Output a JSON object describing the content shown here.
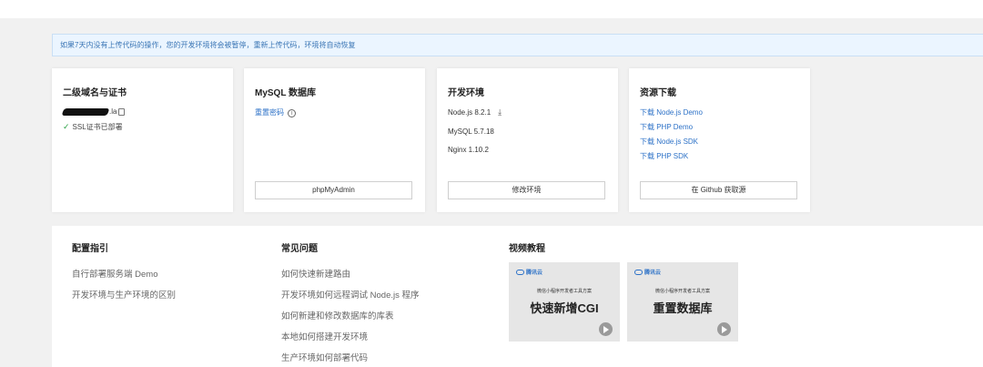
{
  "notice": "如果7天内没有上传代码的操作，您的开发环境将会被暂停，重新上传代码，环境将自动恢复",
  "cards": {
    "domain": {
      "title": "二级域名与证书",
      "domain_suffix": ".la",
      "ssl_status": "SSL证书已部署"
    },
    "mysql": {
      "title": "MySQL 数据库",
      "reset_password": "重置密码",
      "info_glyph": "i",
      "button": "phpMyAdmin"
    },
    "env": {
      "title": "开发环境",
      "node": "Node.js 8.2.1",
      "mysql": "MySQL 5.7.18",
      "nginx": "Nginx 1.10.2",
      "button": "修改环境"
    },
    "resources": {
      "title": "资源下载",
      "links": [
        "下载 Node.js Demo",
        "下载 PHP Demo",
        "下载 Node.js SDK",
        "下载 PHP SDK"
      ],
      "button": "在 Github 获取源"
    }
  },
  "guide": {
    "title": "配置指引",
    "links": [
      "自行部署服务端 Demo",
      "开发环境与生产环境的区别"
    ]
  },
  "faq": {
    "title": "常见问题",
    "links": [
      "如何快速新建路由",
      "开发环境如何远程调试 Node.js 程序",
      "如何新建和修改数据库的库表",
      "本地如何搭建开发环境",
      "生产环境如何部署代码"
    ]
  },
  "videos": {
    "title": "视频教程",
    "items": [
      {
        "brand": "腾讯云",
        "subtitle": "微信小程序开发者工具方案",
        "title": "快速新增CGI"
      },
      {
        "brand": "腾讯云",
        "subtitle": "微信小程序开发者工具方案",
        "title": "重置数据库"
      }
    ]
  },
  "colors": {
    "link": "#2c71c7",
    "notice_bg": "#ebf5ff",
    "notice_text": "#3b76b5",
    "check": "#2ba245"
  }
}
